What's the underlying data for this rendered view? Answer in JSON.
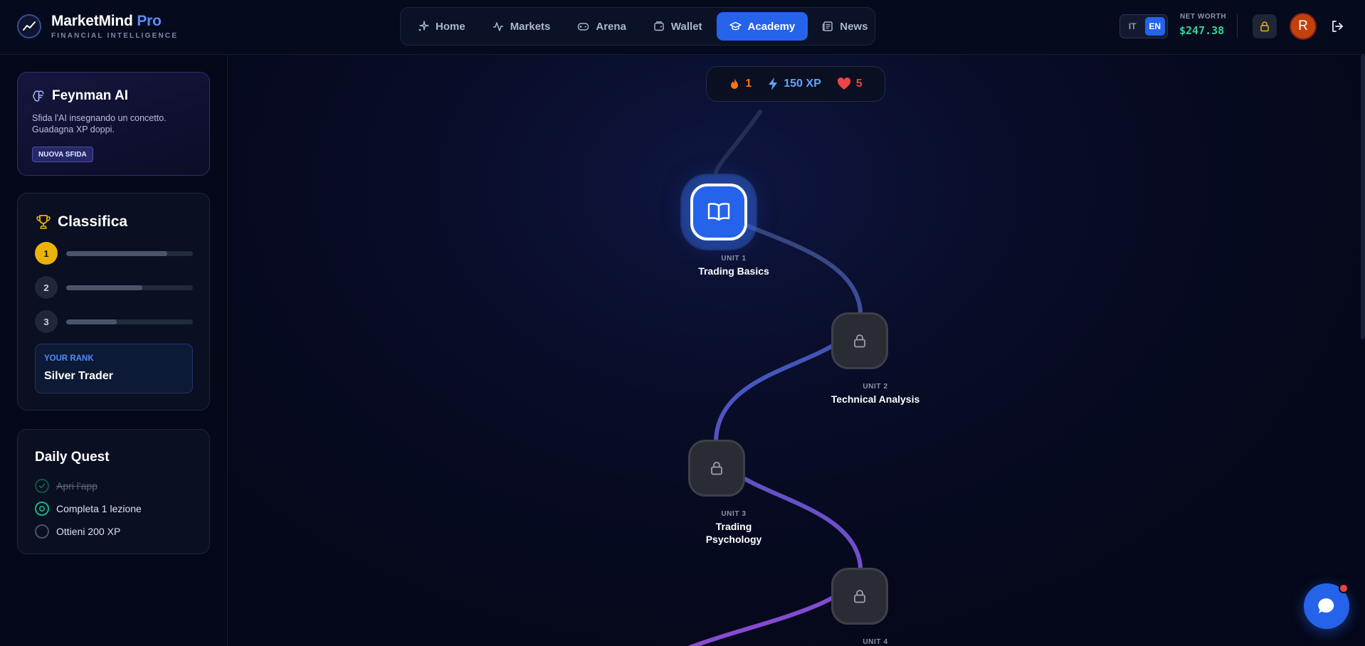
{
  "brand": {
    "name": "MarketMind",
    "suffix": "Pro",
    "tagline": "FINANCIAL INTELLIGENCE"
  },
  "nav": {
    "items": [
      {
        "label": "Home",
        "icon": "sparkle-icon"
      },
      {
        "label": "Markets",
        "icon": "activity-icon"
      },
      {
        "label": "Arena",
        "icon": "gamepad-icon"
      },
      {
        "label": "Wallet",
        "icon": "wallet-icon"
      },
      {
        "label": "Academy",
        "icon": "graduation-cap-icon",
        "active": true
      },
      {
        "label": "News",
        "icon": "newspaper-icon"
      }
    ]
  },
  "header": {
    "lang": {
      "it": "IT",
      "en": "EN",
      "active": "EN"
    },
    "net_worth_label": "NET WORTH",
    "net_worth_value": "$247.38",
    "avatar_initial": "R"
  },
  "sidebar": {
    "feynman": {
      "title": "Feynman AI",
      "description": "Sfida l'AI insegnando un concetto. Guadagna XP doppi.",
      "button": "NUOVA SFIDA"
    },
    "leaderboard": {
      "title": "Classifica",
      "rows": [
        {
          "rank": "1",
          "progress": 0.8
        },
        {
          "rank": "2",
          "progress": 0.6
        },
        {
          "rank": "3",
          "progress": 0.4
        }
      ],
      "your_rank_label": "YOUR RANK",
      "your_rank_value": "Silver Trader"
    },
    "quest": {
      "title": "Daily Quest",
      "items": [
        {
          "label": "Apri l'app",
          "status": "done"
        },
        {
          "label": "Completa 1 lezione",
          "status": "active"
        },
        {
          "label": "Ottieni 200 XP",
          "status": "todo"
        }
      ]
    }
  },
  "stats": {
    "streak": "1",
    "xp": "150 XP",
    "hearts": "5"
  },
  "path": {
    "units": [
      {
        "kicker": "UNIT 1",
        "name": "Trading Basics",
        "status": "active"
      },
      {
        "kicker": "UNIT 2",
        "name": "Technical Analysis",
        "status": "locked"
      },
      {
        "kicker": "UNIT 3",
        "name": "Trading Psychology",
        "status": "locked"
      },
      {
        "kicker": "UNIT 4",
        "name": "",
        "status": "locked"
      }
    ]
  },
  "colors": {
    "accent": "#2563eb",
    "success": "#34d399",
    "streak": "#f97316",
    "xp": "#60a5fa",
    "hearts": "#ef4444",
    "gold": "#eab308"
  }
}
